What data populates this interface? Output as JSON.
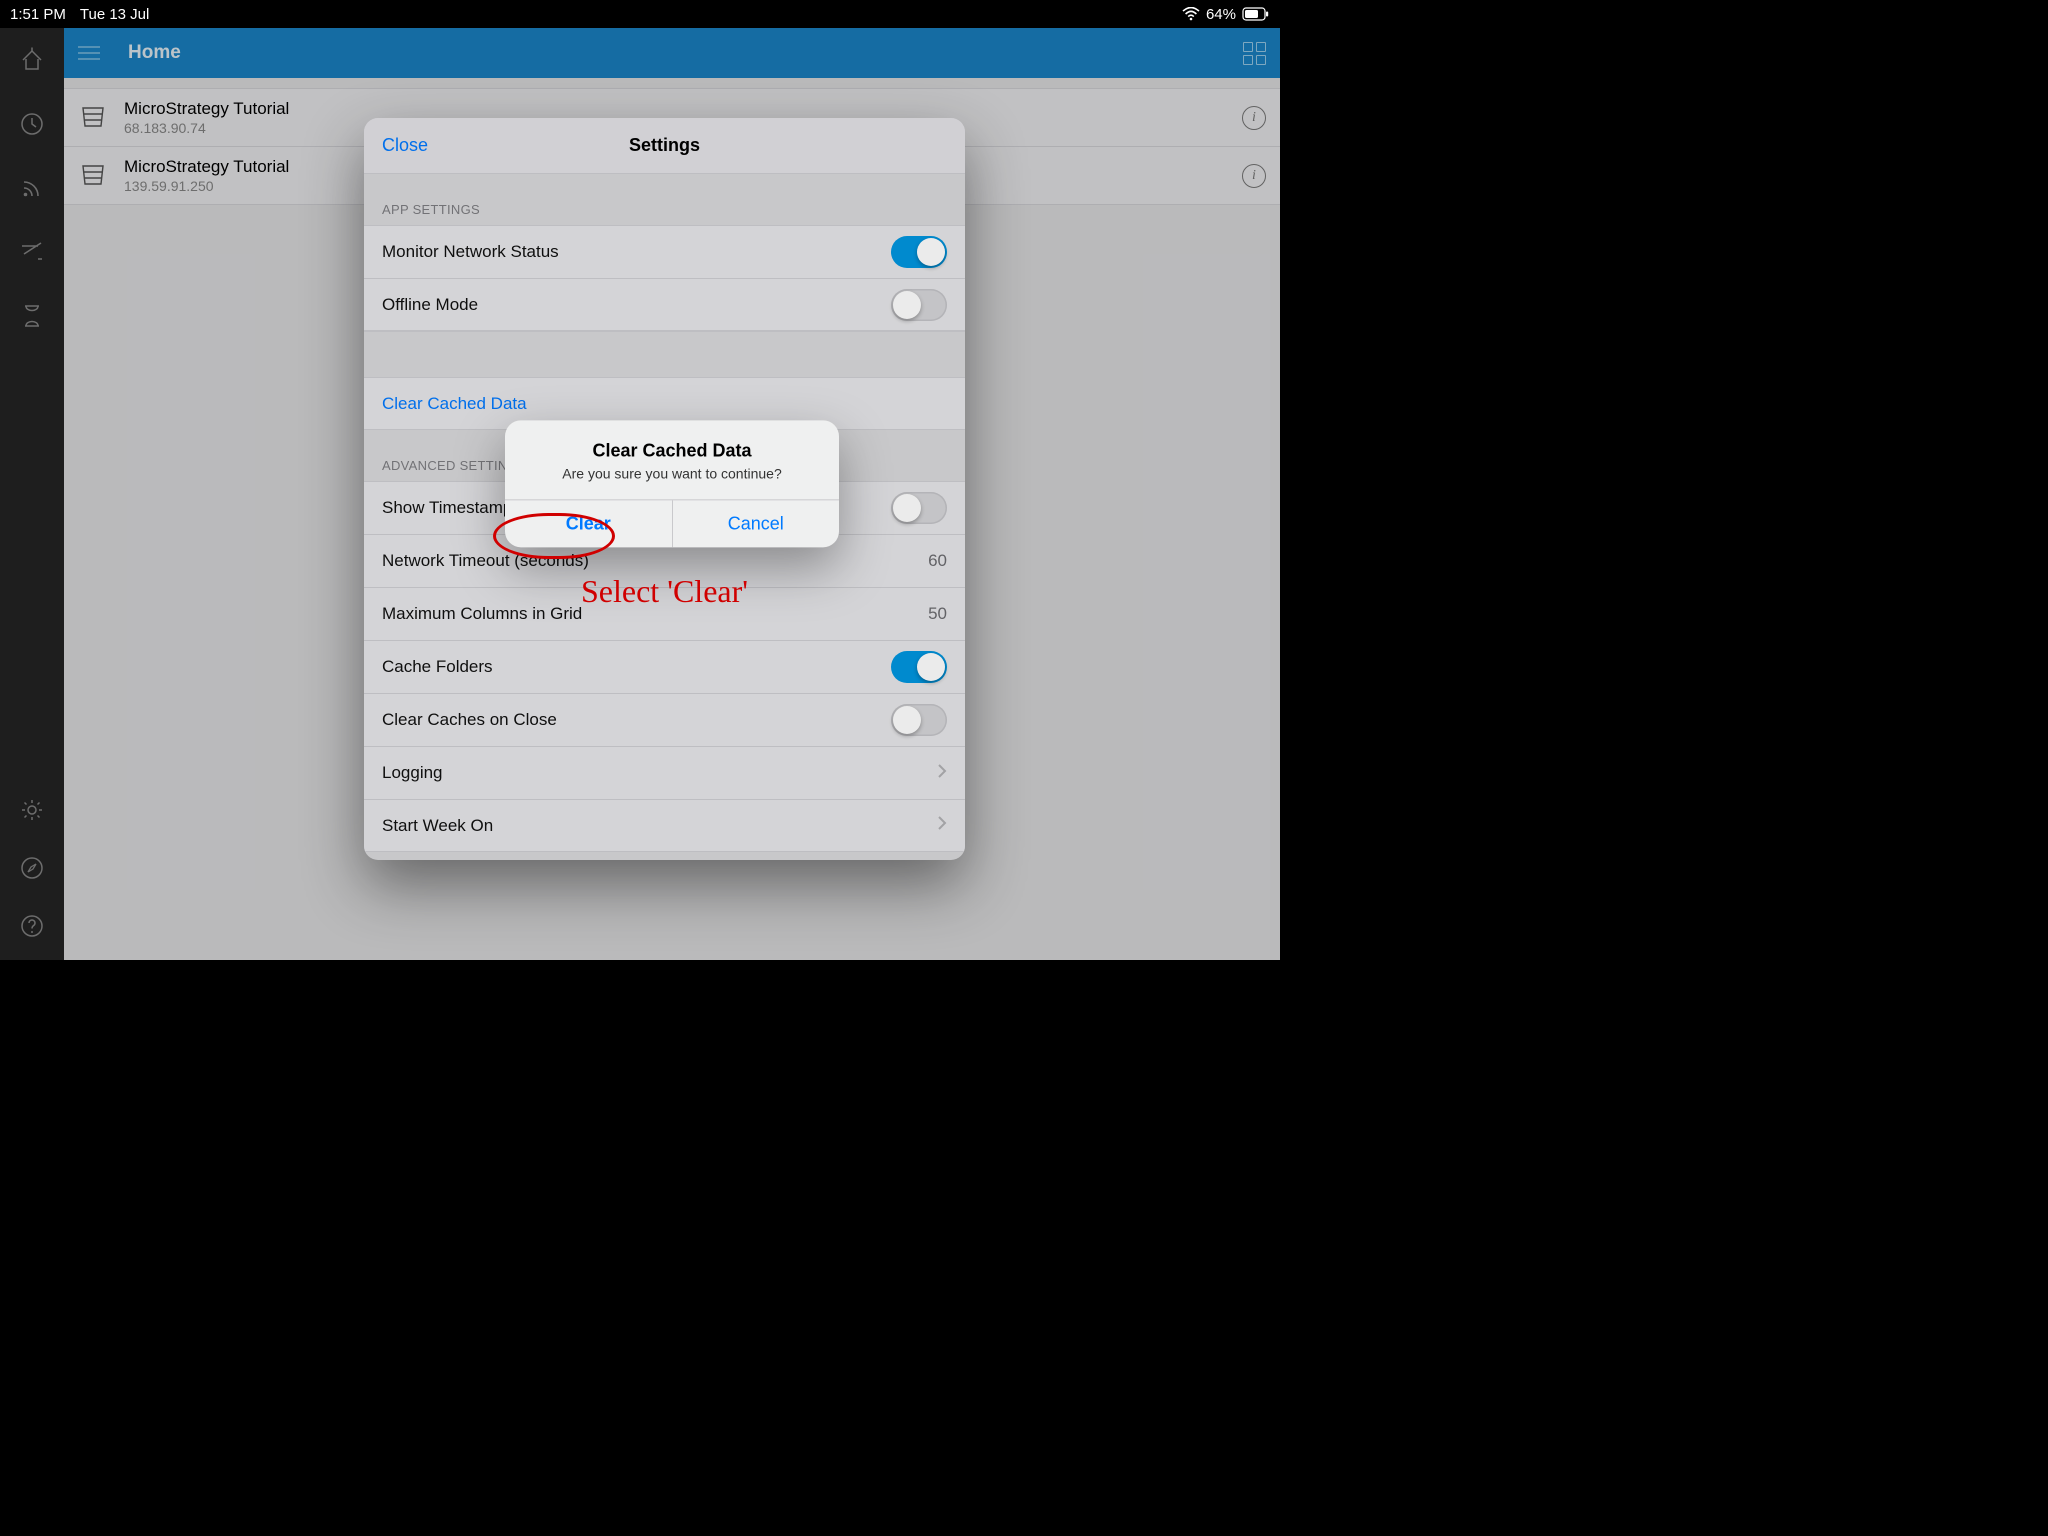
{
  "statusbar": {
    "time": "1:51 PM",
    "date": "Tue 13 Jul",
    "battery": "64%"
  },
  "topbar": {
    "title": "Home"
  },
  "servers": [
    {
      "name": "MicroStrategy Tutorial",
      "ip": "68.183.90.74"
    },
    {
      "name": "MicroStrategy Tutorial",
      "ip": "139.59.91.250"
    }
  ],
  "settings": {
    "close": "Close",
    "title": "Settings",
    "sections": {
      "app": {
        "header": "APP SETTINGS",
        "monitor_label": "Monitor Network Status",
        "offline_label": "Offline Mode",
        "clear_cached_label": "Clear Cached Data"
      },
      "advanced": {
        "header": "ADVANCED SETTINGS",
        "show_timestamp_label": "Show Timestamp",
        "network_timeout_label": "Network Timeout (seconds)",
        "network_timeout_value": "60",
        "max_cols_label": "Maximum Columns in Grid",
        "max_cols_value": "50",
        "cache_folders_label": "Cache Folders",
        "clear_on_close_label": "Clear Caches on Close",
        "logging_label": "Logging",
        "start_week_label": "Start Week On"
      }
    }
  },
  "alert": {
    "title": "Clear Cached Data",
    "message": "Are you sure you want to continue?",
    "clear": "Clear",
    "cancel": "Cancel"
  },
  "annotation": {
    "text": "Select 'Clear'"
  }
}
